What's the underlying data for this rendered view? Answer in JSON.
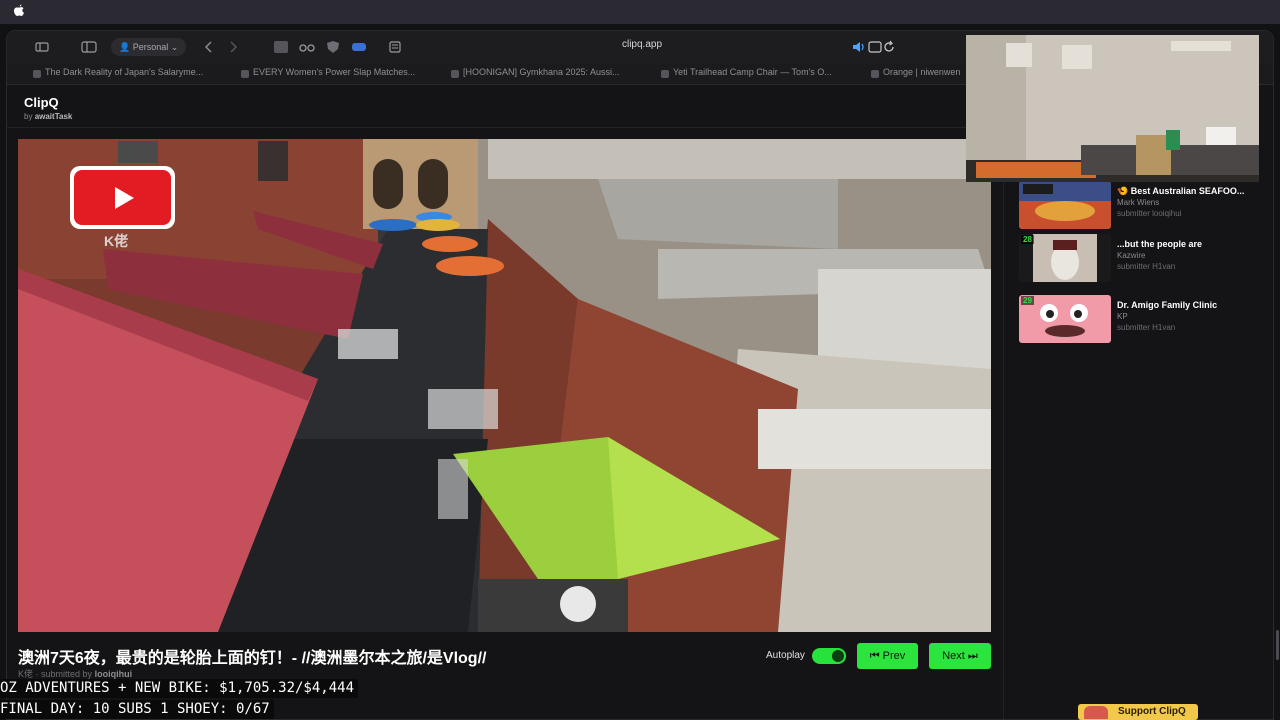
{
  "browser": {
    "profile_label": "Personal",
    "url": "clipq.app",
    "tabs": [
      "The Dark Reality of Japan's Salaryme...",
      "EVERY Women's Power Slap Matches...",
      "[HOONIGAN] Gymkhana 2025: Aussi...",
      "Yeti Trailhead Camp Chair — Tom's O...",
      "Orange | niwenwen"
    ]
  },
  "app": {
    "title": "ClipQ",
    "by_prefix": "by",
    "author": "awaitTask"
  },
  "player": {
    "video_title": "澳洲7天6夜，最贵的是轮胎上面的钉！- //澳洲墨尔本之旅/是Vlog//",
    "channel": "K佬",
    "submitted_by_prefix": "· submitted by",
    "submitted_by": "looiqihui",
    "autoplay_label": "Autoplay",
    "autoplay_on": true,
    "prev_label": "⏮ Prev",
    "next_label": "Next ⏭",
    "watermark_channel": "K佬",
    "accent_color": "#2be53e"
  },
  "queue": [
    {
      "number": "",
      "title": "🍤 Best Australian SEAFOO...",
      "author": "Mark Wiens",
      "submitter": "submitter looiqihui"
    },
    {
      "number": "28",
      "title": "...but the people are",
      "author": "Kazwire",
      "submitter": "submitter H1van"
    },
    {
      "number": "29",
      "title": "Dr. Amigo Family Clinic",
      "author": "KP",
      "submitter": "submitter H1van"
    }
  ],
  "stream_overlay": {
    "line1": "OZ ADVENTURES + NEW BIKE: $1,705.32/$4,444",
    "line2": "FINAL DAY: 10 SUBS 1 SHOEY: 0/67",
    "support_label": "Support ClipQ"
  }
}
